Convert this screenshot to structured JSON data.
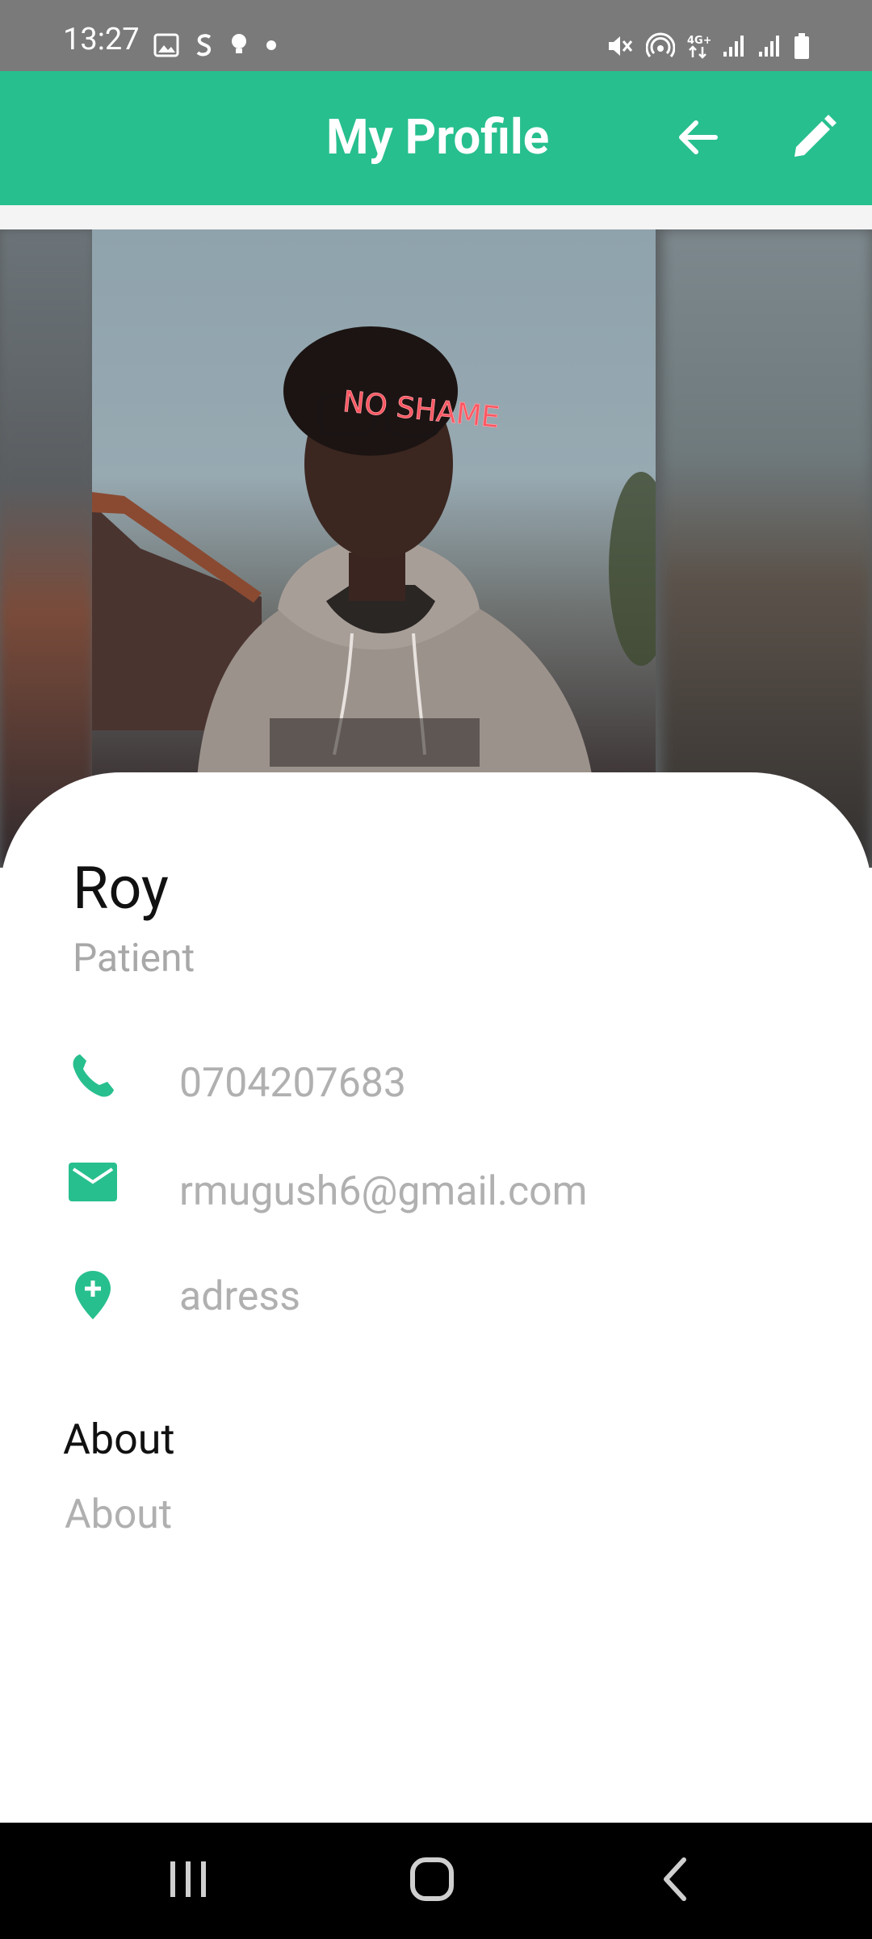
{
  "status_bar": {
    "time": "13:27",
    "left_icons": [
      "image-icon",
      "s-icon",
      "bulb-icon",
      "dot-icon"
    ],
    "right_icons": [
      "mute-icon",
      "hotspot-icon",
      "4g-icon",
      "signal-icon",
      "signal-icon",
      "battery-icon"
    ]
  },
  "app_bar": {
    "title": "My Profile",
    "back_icon": "arrow-back-icon",
    "edit_icon": "pencil-icon",
    "background_color": "#27bf8e"
  },
  "photo": {
    "overlay_text": "NO SHAME",
    "alt": "profile photo"
  },
  "profile": {
    "name": "Roy",
    "role": "Patient",
    "phone": "0704207683",
    "email": "rmugush6@gmail.com",
    "address": "adress"
  },
  "about": {
    "heading": "About",
    "value": "About"
  },
  "colors": {
    "accent": "#27bf8e",
    "muted_text": "#b0b0b0",
    "primary_text": "#111111"
  },
  "nav_bar": {
    "icons": [
      "recents-icon",
      "home-icon",
      "back-icon"
    ]
  }
}
